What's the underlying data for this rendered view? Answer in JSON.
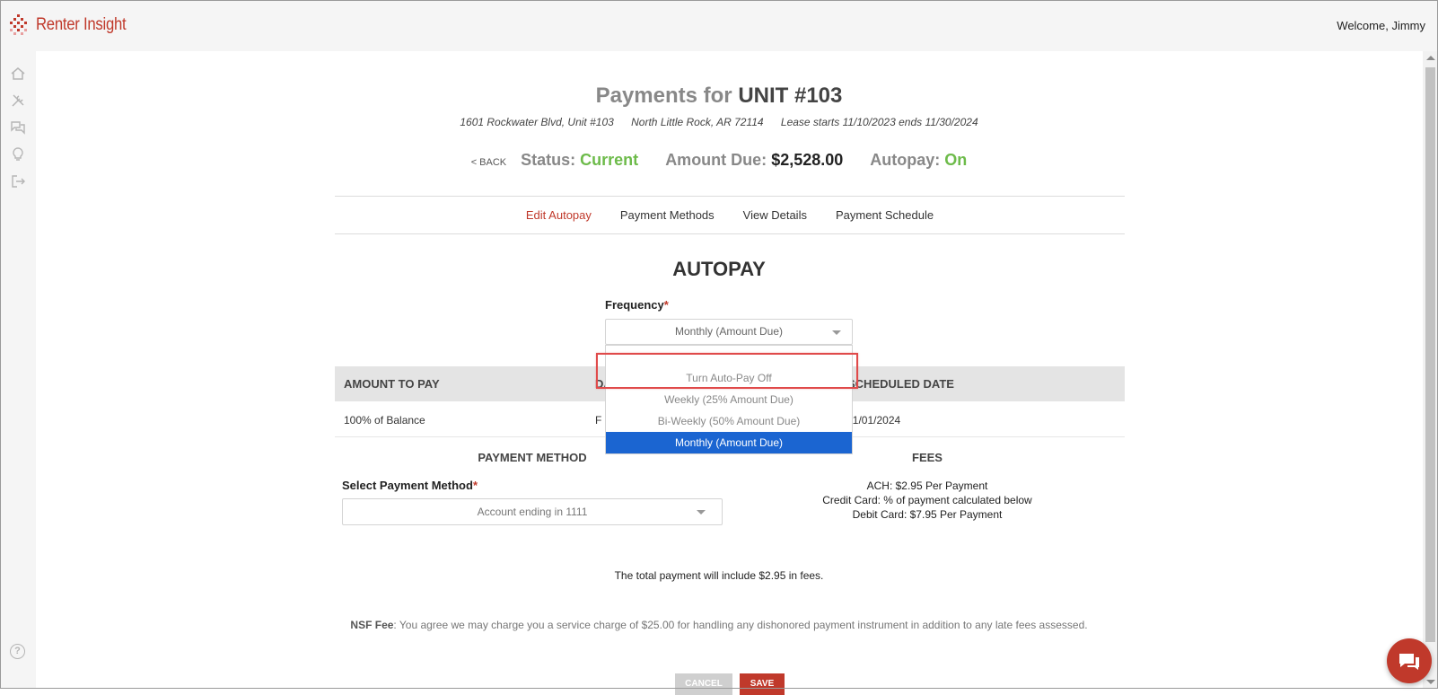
{
  "header": {
    "brand": "Renter Insight",
    "welcome": "Welcome, Jimmy"
  },
  "page": {
    "title_prefix": "Payments for",
    "title_unit": "UNIT #103",
    "address1": "1601 Rockwater Blvd, Unit #103",
    "address2": "North Little Rock, AR 72114",
    "lease": "Lease starts 11/10/2023 ends 11/30/2024"
  },
  "status": {
    "back": "< BACK",
    "status_label": "Status:",
    "status_value": "Current",
    "due_label": "Amount Due:",
    "due_value": "$2,528.00",
    "autopay_label": "Autopay:",
    "autopay_value": "On"
  },
  "tabs": [
    {
      "label": "Edit Autopay",
      "active": true
    },
    {
      "label": "Payment Methods",
      "active": false
    },
    {
      "label": "View Details",
      "active": false
    },
    {
      "label": "Payment Schedule",
      "active": false
    }
  ],
  "autopay": {
    "heading": "AUTOPAY",
    "frequency_label": "Frequency",
    "frequency_value": "Monthly (Amount Due)",
    "options": [
      {
        "label": "",
        "selected": false
      },
      {
        "label": "Turn Auto-Pay Off",
        "selected": false
      },
      {
        "label": "Weekly (25% Amount Due)",
        "selected": false
      },
      {
        "label": "Bi-Weekly (50% Amount Due)",
        "selected": false
      },
      {
        "label": "Monthly (Amount Due)",
        "selected": true
      }
    ]
  },
  "table": {
    "headers": [
      "AMOUNT TO PAY",
      "DA",
      "SCHEDULED DATE"
    ],
    "row": [
      "100% of Balance",
      "F",
      "11/01/2024"
    ]
  },
  "payment_method": {
    "heading": "PAYMENT METHOD",
    "select_label": "Select Payment Method",
    "select_value": "Account ending in 1111"
  },
  "fees": {
    "heading": "FEES",
    "lines": [
      "ACH: $2.95 Per Payment",
      "Credit Card: % of payment calculated below",
      "Debit Card: $7.95 Per Payment"
    ]
  },
  "total_note": "The total payment will include $2.95 in fees.",
  "nsf": {
    "label": "NSF Fee",
    "text": ": You agree we may charge you a service charge of $25.00 for handling any dishonored payment instrument in addition to any late fees assessed."
  },
  "buttons": {
    "cancel": "CANCEL",
    "save": "SAVE"
  },
  "colors": {
    "brand": "#c0392b",
    "status_green": "#6dbb4a",
    "selected_blue": "#1b65d1"
  }
}
